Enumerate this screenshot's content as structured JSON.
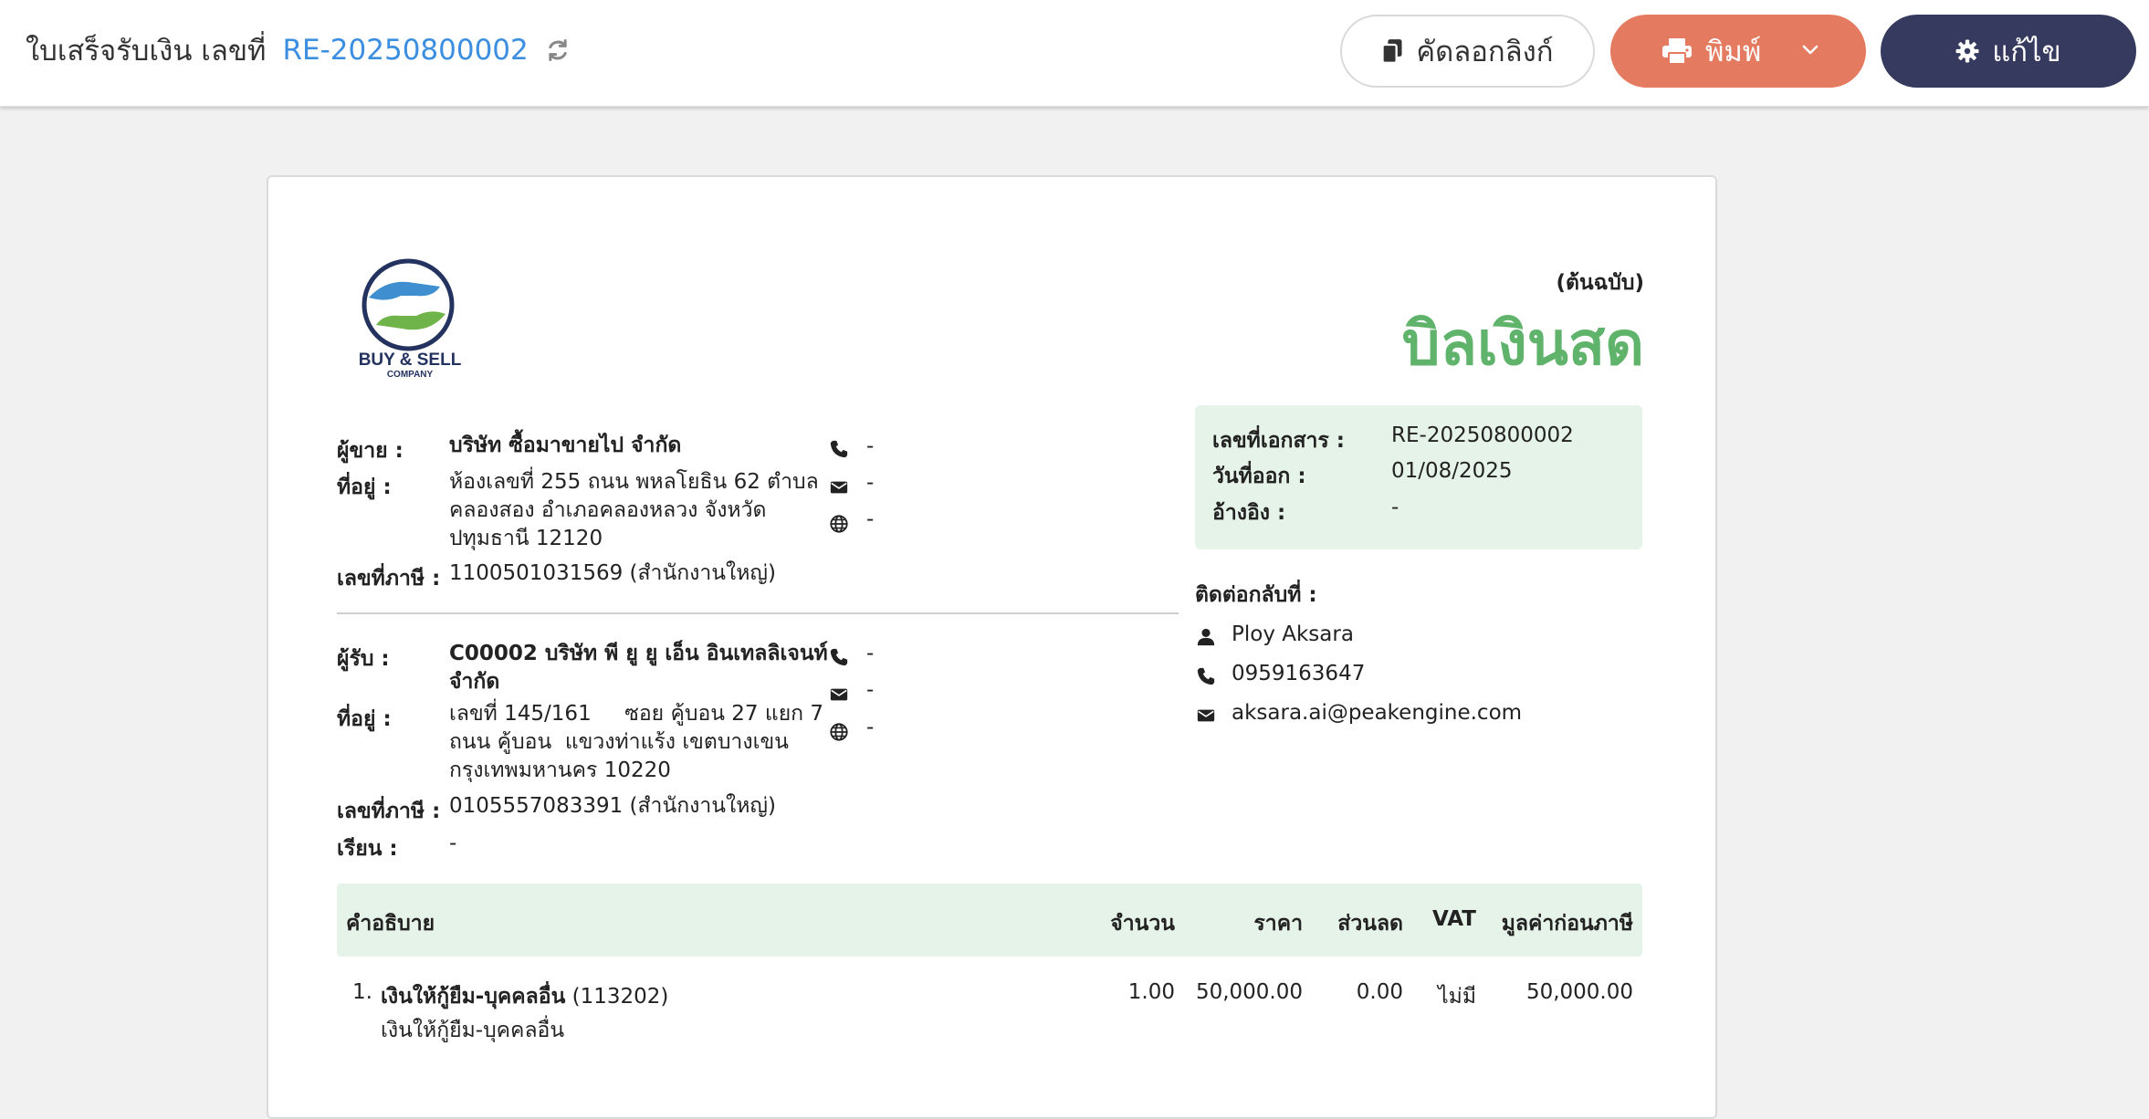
{
  "header": {
    "title_label": "ใบเสร็จรับเงิน เลขที่",
    "doc_number": "RE-20250800002",
    "copy_link_label": "คัดลอกลิงก์",
    "print_label": "พิมพ์",
    "edit_label": "แก้ไข"
  },
  "logo": {
    "line1": "BUY & SELL",
    "line2": "COMPANY"
  },
  "document": {
    "original_label": "(ต้นฉบับ)",
    "title": "บิลเงินสด"
  },
  "seller": {
    "seller_label": "ผู้ขาย :",
    "name": "บริษัท ซื้อมาขายไป จำกัด",
    "address_label": "ที่อยู่ :",
    "address_lines": [
      "ห้องเลขที่ 255 ถนน พหลโยธิน 62 ตำบล",
      "คลองสอง อำเภอคลองหลวง จังหวัด",
      "ปทุมธานี 12120"
    ],
    "tax_label": "เลขที่ภาษี :",
    "tax_id": "1100501031569 (สำนักงานใหญ่)",
    "phone": "-",
    "email": "-",
    "website": "-"
  },
  "buyer": {
    "buyer_label": "ผู้รับ :",
    "name_lines": [
      "C00002 บริษัท พี ยู ยู เอ็น อินเทลลิเจนท์",
      "จำกัด"
    ],
    "address_label": "ที่อยู่ :",
    "address_lines": [
      "เลขที่ 145/161     ซอย คู้บอน 27 แยก 7",
      "ถนน คู้บอน  แขวงท่าแร้ง เขตบางเขน",
      "กรุงเทพมหานคร 10220"
    ],
    "tax_label": "เลขที่ภาษี :",
    "tax_id": "0105557083391 (สำนักงานใหญ่)",
    "attn_label": "เรียน :",
    "attn": "-",
    "phone": "-",
    "email": "-",
    "website": "-"
  },
  "doc_info": {
    "number_label": "เลขที่เอกสาร :",
    "number": "RE-20250800002",
    "date_label": "วันที่ออก :",
    "date": "01/08/2025",
    "ref_label": "อ้างอิง :",
    "ref": "-"
  },
  "contact": {
    "label": "ติดต่อกลับที่ :",
    "name": "Ploy Aksara",
    "phone": "0959163647",
    "email": "aksara.ai@peakengine.com"
  },
  "table": {
    "headers": {
      "description": "คำอธิบาย",
      "qty": "จำนวน",
      "price": "ราคา",
      "discount": "ส่วนลด",
      "vat": "VAT",
      "amount": "มูลค่าก่อนภาษี"
    },
    "rows": [
      {
        "no": "1.",
        "title": "เงินให้กู้ยืม-บุคคลอื่น",
        "code": "(113202)",
        "detail": "เงินให้กู้ยืม-บุคคลอื่น",
        "qty": "1.00",
        "price": "50,000.00",
        "discount": "0.00",
        "vat": "ไม่มี",
        "amount": "50,000.00"
      }
    ]
  },
  "colors": {
    "accent_green": "#5fb36b",
    "box_green": "#e6f3e8",
    "link_blue": "#3b8ee0",
    "print_orange": "#e47b60",
    "edit_navy": "#363a5e"
  }
}
